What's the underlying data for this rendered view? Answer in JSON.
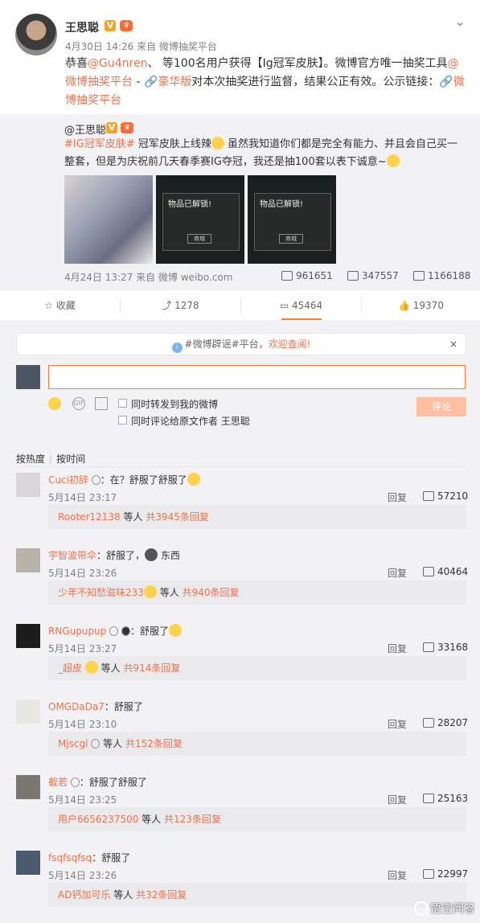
{
  "post": {
    "username": "王思聪",
    "meta": "4月30日 14:26 来自 微博抽奖平台",
    "text": {
      "p1": "恭喜",
      "mention1": "@Gu4nren",
      "p2": "、 等100名用户获得【Ig冠军皮肤】。微博官方唯一抽奖工具",
      "mention2": "@微博抽奖平台",
      "p3": " - ",
      "link1": "豪华版",
      "p4": "对本次抽奖进行监督，结果公正有效。公示链接：",
      "link2": "微博抽奖平台"
    }
  },
  "repost": {
    "username": "@王思聪",
    "hashtag": "#IG冠军皮肤#",
    "text1": " 冠军皮肤上线辣",
    "text2": " 虽然我知道你们都是完全有能力、并且会自己买一整套，但是为庆祝前几天春季赛IG夺冠，我还是抽100套以表下诚意~",
    "dialog_title": "物品已解锁!",
    "dialog_btn": "商城",
    "meta": "4月24日 13:27 来自 微博 weibo.com",
    "reposts": "961651",
    "comments": "347557",
    "likes": "1166188"
  },
  "actions": {
    "favorite": "收藏",
    "repost": "1278",
    "comment": "45464",
    "like": "19370"
  },
  "notice": {
    "prefix": "#微博辟谣#平台，",
    "welcome": "欢迎查阅!",
    "close": "×"
  },
  "composer": {
    "check1": "同时转发到我的微博",
    "check2": "同时评论给原文作者 王思聪",
    "submit": "评论"
  },
  "sort": {
    "hot": "按热度",
    "time": "按时间"
  },
  "comments": [
    {
      "name": "Cuci初辞",
      "text": "：在？舒服了舒服了",
      "time": "5月14日 23:17",
      "reply": "回复",
      "likes": "57210",
      "sub_name": "Rooter12138",
      "sub_mid": " 等人 ",
      "sub_count": "共3945条回复"
    },
    {
      "name": "宇智波带伞",
      "text": "：舒服了，",
      "extra": " 东西",
      "time": "5月14日 23:26",
      "reply": "回复",
      "likes": "40464",
      "sub_name": "少年不知愁滋味233",
      "sub_mid": " 等人 ",
      "sub_count": "共940条回复"
    },
    {
      "name": "RNGupupup",
      "text": "：舒服了",
      "time": "5月14日 23:27",
      "reply": "回复",
      "likes": "33168",
      "sub_name": "_超皮",
      "sub_mid": " 等人 ",
      "sub_count": "共914条回复"
    },
    {
      "name": "OMGDaDa7",
      "text": "：舒服了",
      "time": "5月14日 23:10",
      "reply": "回复",
      "likes": "28207",
      "sub_name": "Mjscgl",
      "sub_mid": " 等人 ",
      "sub_count": "共152条回复"
    },
    {
      "name": "截若",
      "text": "：舒服了舒服了",
      "time": "5月14日 23:25",
      "reply": "回复",
      "likes": "25163",
      "sub_name": "用户6656237500",
      "sub_mid": " 等人 ",
      "sub_count": "共123条回复"
    },
    {
      "name": "fsqfsqfsq",
      "text": "：舒服了",
      "time": "5月14日 23:26",
      "reply": "回复",
      "likes": "22997",
      "sub_name": "AD钙加可乐",
      "sub_mid": " 等人 ",
      "sub_count": "共32条回复"
    }
  ],
  "watermark": "悟空问答"
}
